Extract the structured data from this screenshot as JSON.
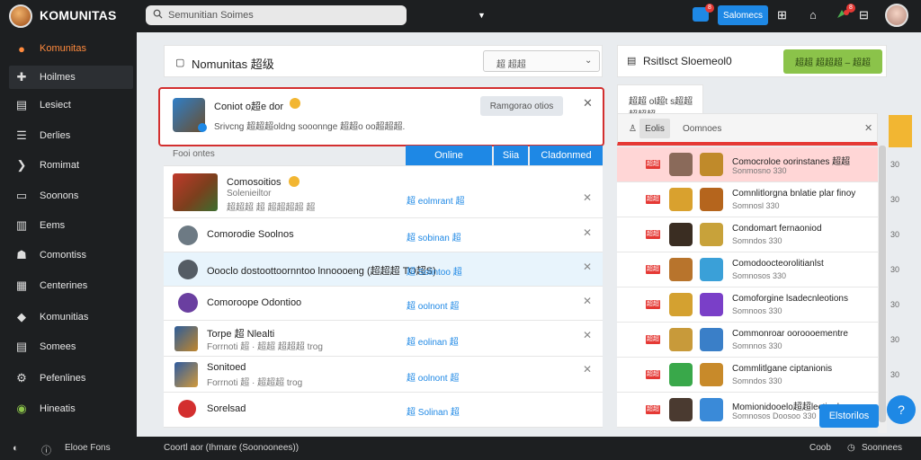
{
  "topbar": {
    "brand": "KOMUNITAS",
    "search_value": "Semunitian Soimes",
    "notif_count": "8",
    "notif_count_2": "8",
    "blue_button": "Salomecs"
  },
  "sidebar": {
    "items": [
      {
        "label": "Komunitas",
        "icon": "flame-icon"
      },
      {
        "label": "Hoilmes",
        "icon": "puzzle-icon"
      },
      {
        "label": "Lesiect",
        "icon": "document-icon"
      },
      {
        "label": "Derlies",
        "icon": "list-icon"
      },
      {
        "label": "Romimat",
        "icon": "comment-icon"
      },
      {
        "label": "Soonons",
        "icon": "folder-icon"
      },
      {
        "label": "Eems",
        "icon": "chart-icon"
      },
      {
        "label": "Comontiss",
        "icon": "people-icon"
      },
      {
        "label": "Centerines",
        "icon": "calendar-icon"
      },
      {
        "label": "Komunitias",
        "icon": "tag-icon"
      },
      {
        "label": "Somees",
        "icon": "grid-icon"
      },
      {
        "label": "Pefenlines",
        "icon": "settings-icon"
      },
      {
        "label": "Hineatis",
        "icon": "android-icon"
      }
    ]
  },
  "main": {
    "title": "Nomunitas 超级",
    "dropdown_label": "超 超超",
    "notice": {
      "title": "Coniot o超e dor",
      "subtitle": "Srivcng 超超超oldng sooonnge 超超o oo超超超.",
      "button": "Ramgorao otios"
    },
    "section_label": "Fooi ontes",
    "tabs": [
      "Online",
      "Siia",
      "Cladonmed"
    ],
    "rows": [
      {
        "name": "Comosoitios",
        "sub": "Solenieiltor",
        "sub2": "超超超 超 超超超超 超",
        "action": "超 eolmrant 超",
        "icon": "avatar-hero"
      },
      {
        "name": "Comorodie Soolnos",
        "action": "超 sobinan 超",
        "icon": "avatar-gray"
      },
      {
        "name": "Oooclo dostoottoornntoo lnnoooeng (超超超 TO超S)",
        "action": "超 Solintoo 超",
        "icon": "avatar-dark"
      },
      {
        "name": "Comoroope Odontioo",
        "action": "超 oolnont 超",
        "icon": "avatar-purple"
      },
      {
        "name": "Torpe 超 Nlealti",
        "sub": "Forrnoti 超 · 超超 超超超 trog",
        "action": "超 eolinan 超",
        "icon": "avatar-warrior"
      },
      {
        "name": "Sonitoed",
        "sub": "Forrnoti 超 · 超超超 trog",
        "action": "超 oolnont 超",
        "icon": "avatar-knight"
      },
      {
        "name": "Sorelsad",
        "action": "超 Solinan 超",
        "icon": "avatar-red"
      }
    ]
  },
  "right": {
    "title": "Rsitlsct Sloemeol0",
    "green_button": "超超 超超超 – 超超",
    "section_label": "超超 ol超t s超超 超超超",
    "tab_label": "Eolis",
    "tab_label_2": "Oomnoes",
    "rows": [
      {
        "rank": "超超",
        "name": "Comocroloe oorinstanes 超超",
        "meta": "Sonmosno 330",
        "score": "30"
      },
      {
        "rank": "超超",
        "name": "Comnlitlorgna bnlatie plar finoy",
        "meta": "Somnosl 330",
        "score": "30"
      },
      {
        "rank": "超超",
        "name": "Condomart fernaoniod",
        "meta": "Somndos 330",
        "score": "30"
      },
      {
        "rank": "超超",
        "name": "Comodoocteorolitianlst",
        "meta": "Somnosos 330",
        "score": "30"
      },
      {
        "rank": "超超",
        "name": "Comoforgine lsadecnleotions",
        "meta": "Somnoos 330",
        "score": "30"
      },
      {
        "rank": "超超",
        "name": "Commonroar ooroooementre",
        "meta": "Somnnos 330",
        "score": "30"
      },
      {
        "rank": "超超",
        "name": "Commlitlgane ciptanionis",
        "meta": "Somndos 330",
        "score": "30"
      },
      {
        "rank": "超超",
        "name": "Momionidooelo超超lectionls",
        "meta": "Somnosos Doosoo 330",
        "score": "30"
      }
    ],
    "float_button": "Elstorilos"
  },
  "bottombar": {
    "left": "Elooe Fons",
    "center": "Coortl aor (Ihmare (Soonoonees))",
    "right_1": "Coob",
    "right_2": "Soonnees"
  },
  "colors": {
    "accent_blue": "#1e88e5",
    "accent_orange": "#ff8a3d",
    "highlight_red": "#e53935",
    "green": "#8bc34a",
    "dark": "#1d1f21"
  }
}
